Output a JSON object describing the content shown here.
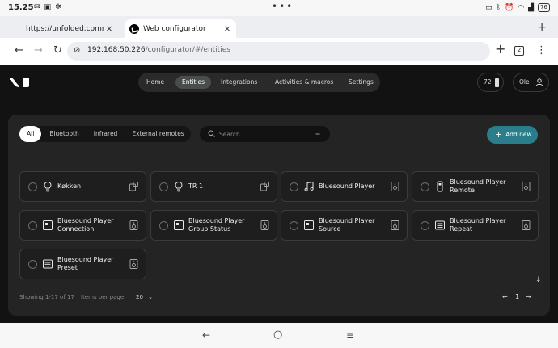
{
  "status_bar": {
    "time": "15.25",
    "left_icons": [
      "mail-icon",
      "gallery-icon",
      "fan-icon"
    ],
    "battery_level": "76"
  },
  "tabs": [
    {
      "label": "https://unfolded.community/t",
      "close": "×"
    },
    {
      "label": "Web configurator",
      "close": "×"
    }
  ],
  "toolbar": {
    "url_host": "192.168.50.226",
    "url_path": "/configurator/#/entities",
    "tab_count": "2"
  },
  "app": {
    "nav": [
      "Home",
      "Entities",
      "Integrations",
      "Activities & macros",
      "Settings"
    ],
    "active_nav": "Entities",
    "battery": "72",
    "user": "Ole",
    "filters": [
      "All",
      "Bluetooth",
      "Infrared",
      "External remotes"
    ],
    "active_filter": "All",
    "search_placeholder": "Search",
    "add_new": "Add new",
    "entities": [
      {
        "title": "Køkken",
        "icon": "lightbulb-icon"
      },
      {
        "title": "TR 1",
        "icon": "lightbulb-icon"
      },
      {
        "title": "Bluesound Player",
        "icon": "music-note-icon"
      },
      {
        "title": "Bluesound Player Remote",
        "icon": "remote-icon"
      },
      {
        "title": "Bluesound Player Connection",
        "icon": "sensor-icon"
      },
      {
        "title": "Bluesound Player Group Status",
        "icon": "sensor-icon"
      },
      {
        "title": "Bluesound Player Source",
        "icon": "sensor-icon"
      },
      {
        "title": "Bluesound Player Repeat",
        "icon": "select-icon"
      },
      {
        "title": "Bluesound Player Preset",
        "icon": "select-icon"
      }
    ],
    "showing": "Showing 1-17 of 17",
    "items_per_page_label": "Items per page:",
    "items_per_page": "20",
    "page": "1"
  },
  "colors": {
    "accent": "#2a7d8a",
    "page_bg": "#121212",
    "panel_bg": "#242424"
  }
}
